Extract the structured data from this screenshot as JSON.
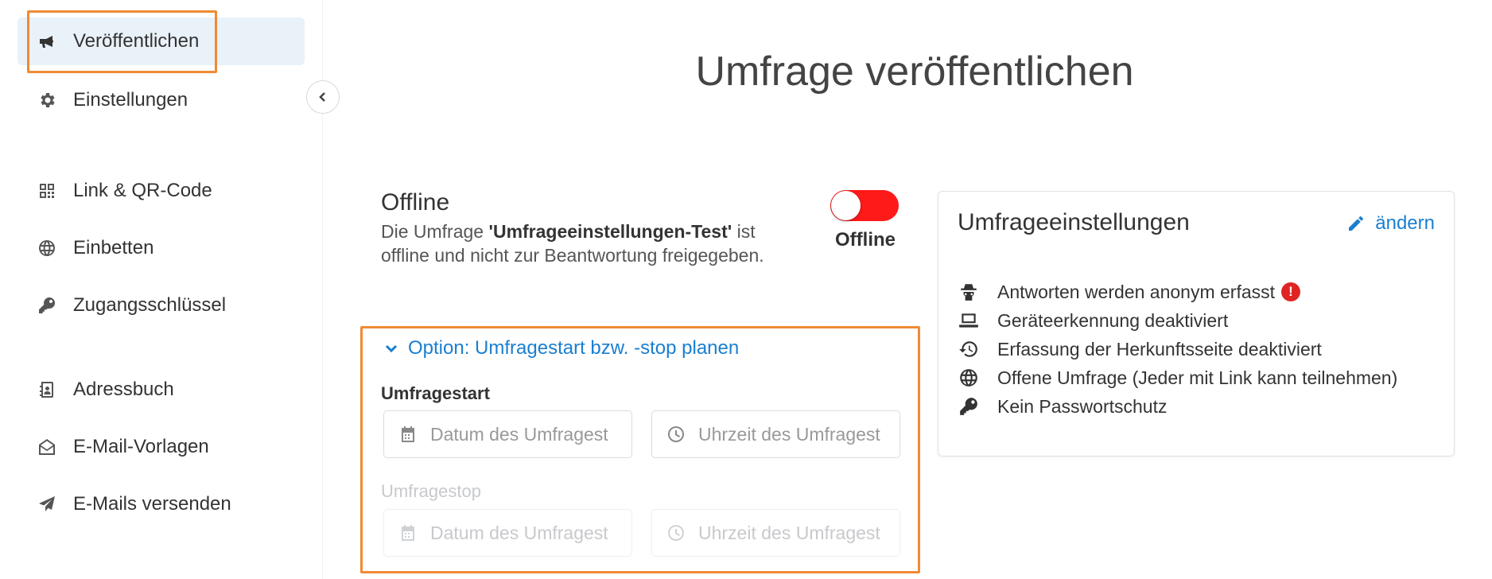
{
  "sidebar": {
    "items": [
      {
        "label": "Veröffentlichen",
        "icon": "megaphone-icon"
      },
      {
        "label": "Einstellungen",
        "icon": "gear-icon"
      },
      {
        "label": "Link & QR-Code",
        "icon": "qr-code-icon"
      },
      {
        "label": "Einbetten",
        "icon": "globe-icon"
      },
      {
        "label": "Zugangsschlüssel",
        "icon": "key-icon"
      },
      {
        "label": "Adressbuch",
        "icon": "address-book-icon"
      },
      {
        "label": "E-Mail-Vorlagen",
        "icon": "envelope-open-icon"
      },
      {
        "label": "E-Mails versenden",
        "icon": "paper-plane-icon"
      }
    ],
    "active_index": 0
  },
  "main": {
    "title": "Umfrage veröffentlichen",
    "status": {
      "heading": "Offline",
      "desc_prefix": "Die Umfrage ",
      "survey_name": "'Umfrageeinstellungen-Test'",
      "desc_suffix": " ist offline und nicht zur Beantwortung freigegeben.",
      "toggle_label": "Offline",
      "toggle_color": "#ff1a1a"
    },
    "schedule": {
      "toggle_label": "Option: Umfragestart bzw. -stop planen",
      "start_label": "Umfragestart",
      "stop_label": "Umfragestop",
      "date_placeholder": "Datum des Umfragest",
      "time_placeholder": "Uhrzeit des Umfragest"
    }
  },
  "settings_card": {
    "title": "Umfrageeinstellungen",
    "edit_label": "ändern",
    "items": [
      {
        "text": "Antworten werden anonym erfasst",
        "icon": "spy-icon",
        "warning": "!"
      },
      {
        "text": "Geräteerkennung deaktiviert",
        "icon": "laptop-icon"
      },
      {
        "text": "Erfassung der Herkunftsseite deaktiviert",
        "icon": "history-icon"
      },
      {
        "text": "Offene Umfrage (Jeder mit Link kann teilnehmen)",
        "icon": "globe-icon"
      },
      {
        "text": "Kein Passwortschutz",
        "icon": "key-icon"
      }
    ]
  },
  "colors": {
    "accent": "#1a7fd0",
    "highlight_border": "#f08a34",
    "active_nav_bg": "#e9f1f9",
    "warning": "#e02424"
  }
}
